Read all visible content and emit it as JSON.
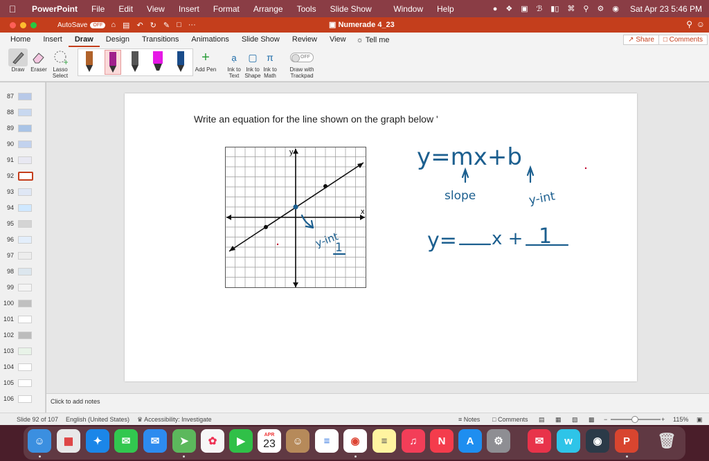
{
  "menubar": {
    "app_name": "PowerPoint",
    "items": [
      "File",
      "Edit",
      "View",
      "Insert",
      "Format",
      "Arrange",
      "Tools",
      "Slide Show",
      "Window",
      "Help"
    ],
    "datetime": "Sat Apr 23  5:46 PM"
  },
  "titlebar": {
    "autosave_label": "AutoSave",
    "autosave_state": "OFF",
    "doc_title": "Numerade 4_23",
    "more": "···"
  },
  "tabs": {
    "items": [
      "Home",
      "Insert",
      "Draw",
      "Design",
      "Transitions",
      "Animations",
      "Slide Show",
      "Review",
      "View"
    ],
    "active": "Draw",
    "tell_me": "Tell me",
    "share": "Share",
    "comments": "Comments"
  },
  "ribbon": {
    "draw": "Draw",
    "eraser": "Eraser",
    "lasso_1": "Lasso",
    "lasso_2": "Select",
    "add_pen": "Add Pen",
    "ink_text_1": "Ink to",
    "ink_text_2": "Text",
    "ink_shape_1": "Ink to",
    "ink_shape_2": "Shape",
    "ink_math_1": "Ink to",
    "ink_math_2": "Math",
    "trackpad_state": "OFF",
    "trackpad_1": "Draw with",
    "trackpad_2": "Trackpad",
    "pen_colors": [
      "#b0622a",
      "#a0208c",
      "#555555",
      "#e619e6",
      "#1a4c8a"
    ]
  },
  "thumbnails": [
    "87",
    "88",
    "89",
    "90",
    "91",
    "92",
    "93",
    "94",
    "95",
    "96",
    "97",
    "98",
    "99",
    "100",
    "101",
    "102",
    "103",
    "104",
    "105",
    "106"
  ],
  "selected_slide": "92",
  "slide": {
    "title": "Write an equation for the line shown on the graph below '",
    "axis_x": "x",
    "axis_y": "y"
  },
  "ink": {
    "equation": "y=mx+b",
    "slope_label": "slope",
    "yint_label": "y-int",
    "yint_label_graph": "y-int",
    "yint_value_graph": "1",
    "answer_lhs": "y=",
    "answer_mid": "x +",
    "answer_intercept": "1",
    "ink_color": "#1c5f8f"
  },
  "notes": {
    "placeholder": "Click to add notes"
  },
  "status": {
    "slide_info": "Slide 92 of 107",
    "language": "English (United States)",
    "accessibility": "Accessibility: Investigate",
    "notes": "Notes",
    "comments": "Comments",
    "zoom_minus": "−",
    "zoom_plus": "+",
    "zoom": "115%"
  },
  "dock": {
    "calendar_month": "APR",
    "calendar_day": "23",
    "apps": [
      "finder-icon",
      "launchpad-icon",
      "safari-icon",
      "messages-icon",
      "mail-icon",
      "maps-icon",
      "photos-icon",
      "facetime-icon",
      "calendar-icon",
      "contacts-icon",
      "reminders-icon",
      "chrome-icon",
      "notes-icon",
      "music-icon",
      "news-icon",
      "appstore-icon",
      "system-preferences-icon",
      "email-icon",
      "word-icon",
      "preview-icon",
      "powerpoint-icon",
      "trash-icon"
    ]
  }
}
